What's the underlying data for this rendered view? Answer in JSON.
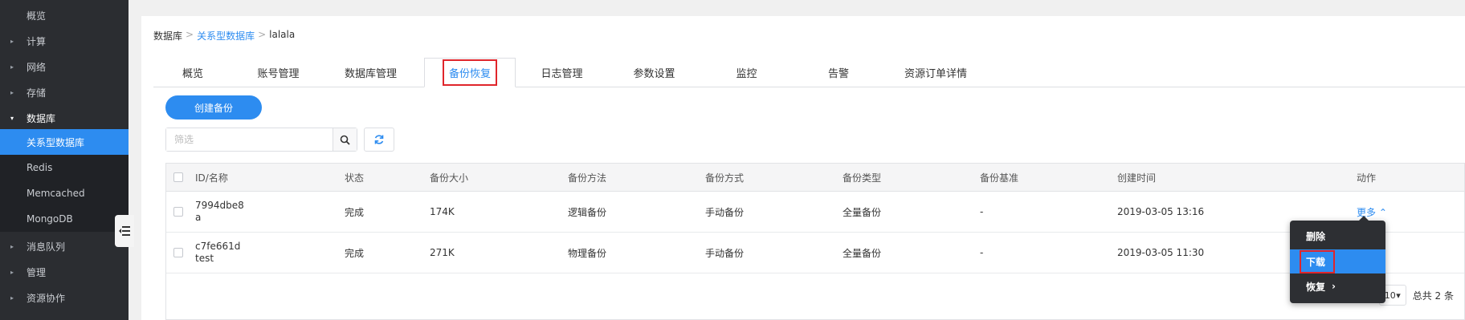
{
  "sidebar": {
    "items": [
      {
        "label": "概览",
        "arrow": ""
      },
      {
        "label": "计算",
        "arrow": "▸"
      },
      {
        "label": "网络",
        "arrow": "▸"
      },
      {
        "label": "存储",
        "arrow": "▸"
      },
      {
        "label": "数据库",
        "arrow": "▾"
      },
      {
        "label": "关系型数据库",
        "arrow": ""
      },
      {
        "label": "Redis",
        "arrow": ""
      },
      {
        "label": "Memcached",
        "arrow": ""
      },
      {
        "label": "MongoDB",
        "arrow": ""
      },
      {
        "label": "消息队列",
        "arrow": "▸"
      },
      {
        "label": "管理",
        "arrow": "▸"
      },
      {
        "label": "资源协作",
        "arrow": "▸"
      }
    ],
    "collapse_icon": "collapse-menu-icon"
  },
  "breadcrumb": {
    "root": "数据库",
    "sep": ">",
    "link": "关系型数据库",
    "current": "lalala"
  },
  "tabs": [
    "概览",
    "账号管理",
    "数据库管理",
    "备份恢复",
    "日志管理",
    "参数设置",
    "监控",
    "告警",
    "资源订单详情"
  ],
  "toolbar": {
    "create_label": "创建备份",
    "filter_placeholder": "筛选"
  },
  "table": {
    "headers": [
      "ID/名称",
      "状态",
      "备份大小",
      "备份方法",
      "备份方式",
      "备份类型",
      "备份基准",
      "创建时间",
      "动作"
    ],
    "rows": [
      {
        "id": "7994dbe8",
        "name": "a",
        "status": "完成",
        "size": "174K",
        "method": "逻辑备份",
        "mode": "手动备份",
        "type": "全量备份",
        "base": "-",
        "created": "2019-03-05 13:16",
        "action": "更多 ⌃"
      },
      {
        "id": "c7fe661d",
        "name": "test",
        "status": "完成",
        "size": "271K",
        "method": "物理备份",
        "mode": "手动备份",
        "type": "全量备份",
        "base": "-",
        "created": "2019-03-05 11:30",
        "action": ""
      }
    ]
  },
  "pager": {
    "page_size": "10",
    "total": "总共 2 条"
  },
  "dropdown": {
    "items": [
      "删除",
      "下载",
      "恢复"
    ]
  },
  "colors": {
    "accent": "#2d8cf0",
    "sidebar_bg": "#2b2d31",
    "highlight_box": "#e0252b"
  }
}
